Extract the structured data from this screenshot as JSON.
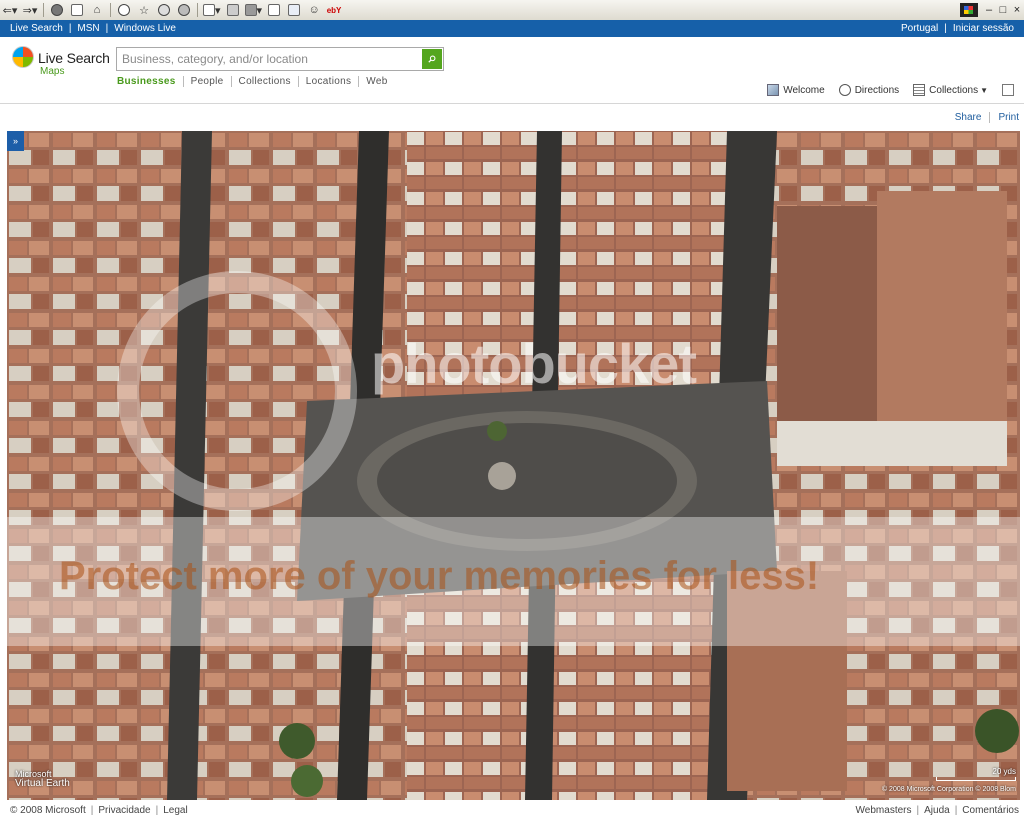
{
  "toolbar": {
    "ebay_label": "ebY",
    "icons": [
      "back-icon",
      "forward-icon",
      "stop-icon",
      "refresh-icon",
      "home-icon",
      "search-icon",
      "favorites-icon",
      "media-icon",
      "history-icon",
      "mail-icon",
      "print-icon",
      "edit-icon",
      "discuss-icon",
      "messenger-icon",
      "ebay-icon"
    ],
    "window_controls": [
      "–",
      "□",
      "×"
    ]
  },
  "topbar": {
    "left_links": [
      "Live Search",
      "MSN",
      "Windows Live"
    ],
    "region": "Portugal",
    "signin": "Iniciar sessão"
  },
  "header": {
    "logo_title": "Live Search",
    "logo_subtitle": "Maps",
    "search_placeholder": "Business, category, and/or location",
    "tabs": [
      "Businesses",
      "People",
      "Collections",
      "Locations",
      "Web"
    ],
    "active_tab": "Businesses",
    "actions": {
      "welcome": "Welcome",
      "directions": "Directions",
      "collections": "Collections"
    },
    "share": "Share",
    "print": "Print"
  },
  "map": {
    "expand_label": "»",
    "brand_line1": "Microsoft",
    "brand_line2": "Virtual Earth",
    "scale_label": "20 yds",
    "copyright": "© 2008 Microsoft Corporation  © 2008 Blom",
    "watermark_logo": "photobucket",
    "watermark_text": "Protect more of your memories for less!"
  },
  "footer": {
    "copyright": "© 2008 Microsoft",
    "privacy": "Privacidade",
    "legal": "Legal",
    "webmasters": "Webmasters",
    "help": "Ajuda",
    "comments": "Comentários"
  },
  "colors": {
    "topbar_blue": "#1660a9",
    "accent_green": "#54a61e",
    "link_blue": "#1f5d9e"
  }
}
